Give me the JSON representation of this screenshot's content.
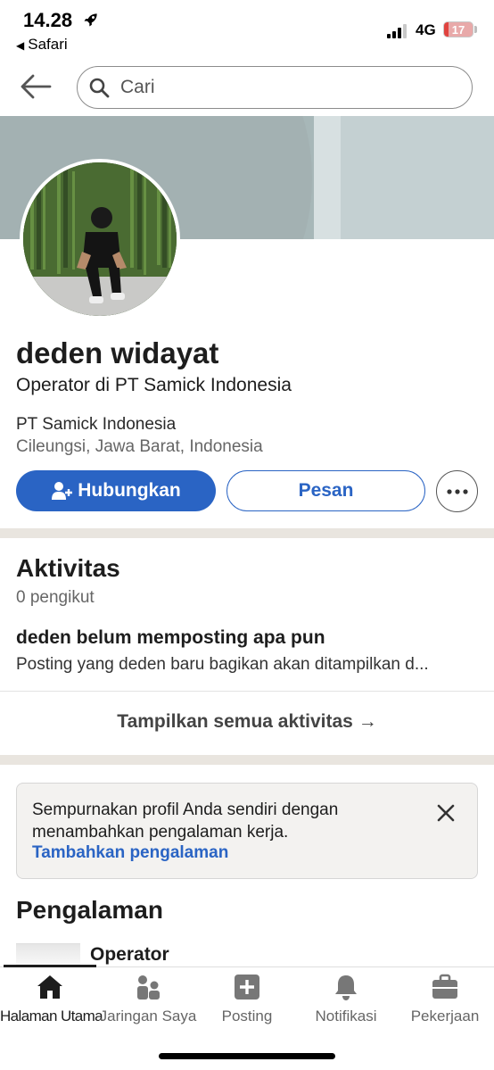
{
  "status_bar": {
    "time": "14.28",
    "back_app": "Safari",
    "network": "4G",
    "battery_percent": 17,
    "battery_text": "17"
  },
  "search": {
    "placeholder": "Cari"
  },
  "profile": {
    "name": "deden widayat",
    "headline": "Operator di PT Samick Indonesia",
    "company": "PT Samick Indonesia",
    "location": "Cileungsi, Jawa Barat, Indonesia"
  },
  "actions": {
    "connect_label": "Hubungkan",
    "message_label": "Pesan"
  },
  "activity": {
    "title": "Aktivitas",
    "followers": "0 pengikut",
    "empty_title": "deden belum memposting apa pun",
    "empty_text": "Posting yang deden baru bagikan akan ditampilkan d...",
    "show_all": "Tampilkan semua aktivitas →"
  },
  "notice": {
    "text": "Sempurnakan profil Anda sendiri dengan menambahkan pengalaman kerja.",
    "link": "Tambahkan pengalaman"
  },
  "experience": {
    "title": "Pengalaman",
    "items": [
      {
        "role": "Operator"
      }
    ]
  },
  "bottom_nav": {
    "items": [
      {
        "label": "Halaman Utama",
        "icon": "home-icon",
        "active": true
      },
      {
        "label": "Jaringan Saya",
        "icon": "network-icon",
        "active": false
      },
      {
        "label": "Posting",
        "icon": "post-icon",
        "active": false
      },
      {
        "label": "Notifikasi",
        "icon": "bell-icon",
        "active": false
      },
      {
        "label": "Pekerjaan",
        "icon": "briefcase-icon",
        "active": false
      }
    ]
  },
  "colors": {
    "accent": "#2a64c4",
    "cover": "#a7b7b8",
    "divider": "#e9e5df"
  }
}
